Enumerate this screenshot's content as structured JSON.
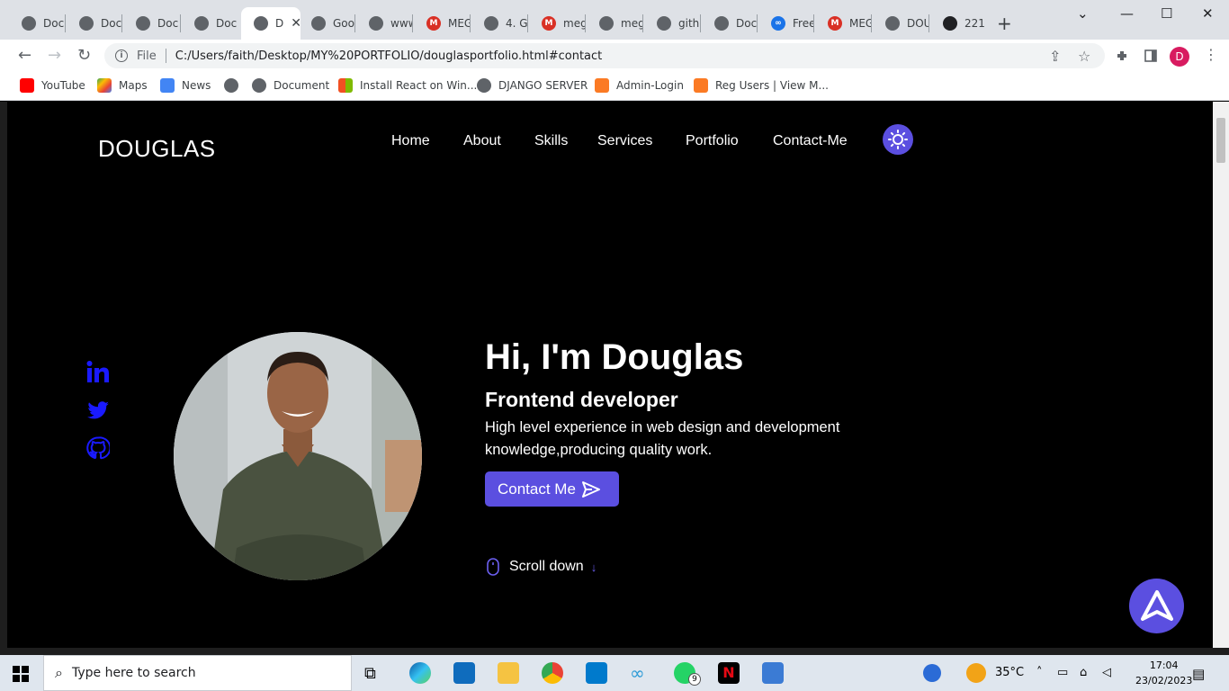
{
  "browser": {
    "tabs": [
      {
        "label": "Docu",
        "icon": "globe-icon"
      },
      {
        "label": "Docu",
        "icon": "globe-icon"
      },
      {
        "label": "Docu",
        "icon": "globe-icon"
      },
      {
        "label": "Docu",
        "icon": "globe-icon"
      },
      {
        "label": "D",
        "icon": "globe-icon",
        "active": true
      },
      {
        "label": "Goo",
        "icon": "globe-icon"
      },
      {
        "label": "www",
        "icon": "globe-icon"
      },
      {
        "label": "MEG",
        "icon": "gmail-icon"
      },
      {
        "label": "4. G",
        "icon": "globe-icon"
      },
      {
        "label": "meg",
        "icon": "gmail-icon"
      },
      {
        "label": "meg",
        "icon": "globe-icon"
      },
      {
        "label": "githu",
        "icon": "globe-icon"
      },
      {
        "label": "Doc",
        "icon": "globe-icon"
      },
      {
        "label": "Free",
        "icon": "infinity-icon"
      },
      {
        "label": "MEG",
        "icon": "gmail-icon"
      },
      {
        "label": "DOU",
        "icon": "globe-icon"
      },
      {
        "label": "221",
        "icon": "eye-icon"
      }
    ],
    "new_tab": "+",
    "url_scheme": "File",
    "url": "C:/Users/faith/Desktop/MY%20PORTFOLIO/douglasportfolio.html#contact",
    "profile_initial": "D",
    "bookmarks": [
      {
        "label": "YouTube"
      },
      {
        "label": "Maps"
      },
      {
        "label": "News"
      },
      {
        "label": ""
      },
      {
        "label": "Document"
      },
      {
        "label": "Install React on Win..."
      },
      {
        "label": "DJANGO SERVER"
      },
      {
        "label": "Admin-Login"
      },
      {
        "label": "Reg Users | View M..."
      }
    ]
  },
  "site": {
    "logo": "DOUGLAS",
    "nav": [
      "Home",
      "About",
      "Skills",
      "Services",
      "Portfolio",
      "Contact-Me"
    ],
    "hero": {
      "title": "Hi, I'm Douglas",
      "subtitle": "Frontend developer",
      "description": "High level experience in web design and development knowledge,producing quality work.",
      "cta": "Contact Me",
      "scroll": "Scroll down"
    },
    "accent": "#5b4fe0",
    "social_color": "#1a1aff"
  },
  "taskbar": {
    "search_placeholder": "Type here to search",
    "weather": "35°C",
    "time": "17:04",
    "date": "23/02/2023",
    "whatsapp_badge": "9"
  }
}
